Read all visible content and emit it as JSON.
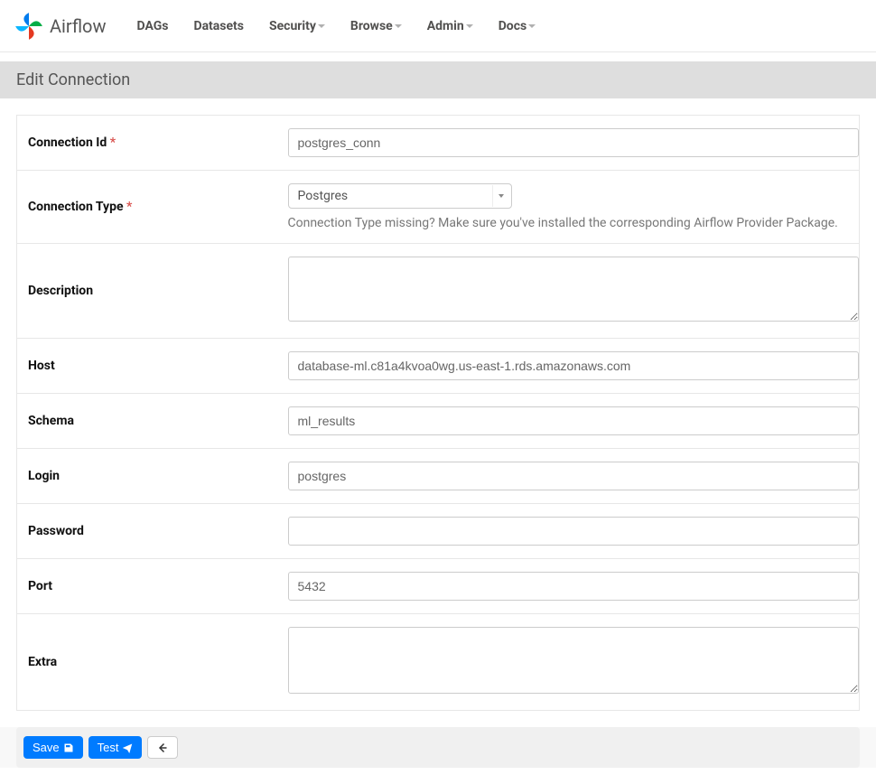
{
  "brand": {
    "name": "Airflow"
  },
  "nav": {
    "dags": "DAGs",
    "datasets": "Datasets",
    "security": "Security",
    "browse": "Browse",
    "admin": "Admin",
    "docs": "Docs"
  },
  "page": {
    "title": "Edit Connection"
  },
  "form": {
    "labels": {
      "conn_id": "Connection Id",
      "conn_type": "Connection Type",
      "description": "Description",
      "host": "Host",
      "schema": "Schema",
      "login": "Login",
      "password": "Password",
      "port": "Port",
      "extra": "Extra"
    },
    "values": {
      "conn_id": "postgres_conn",
      "conn_type": "Postgres",
      "description": "",
      "host": "database-ml.c81a4kvoa0wg.us-east-1.rds.amazonaws.com",
      "schema": "ml_results",
      "login": "postgres",
      "password": "",
      "port": "5432",
      "extra": ""
    },
    "help": {
      "conn_type": "Connection Type missing? Make sure you've installed the corresponding Airflow Provider Package."
    },
    "required_marker": " *"
  },
  "buttons": {
    "save": "Save",
    "test": "Test"
  }
}
